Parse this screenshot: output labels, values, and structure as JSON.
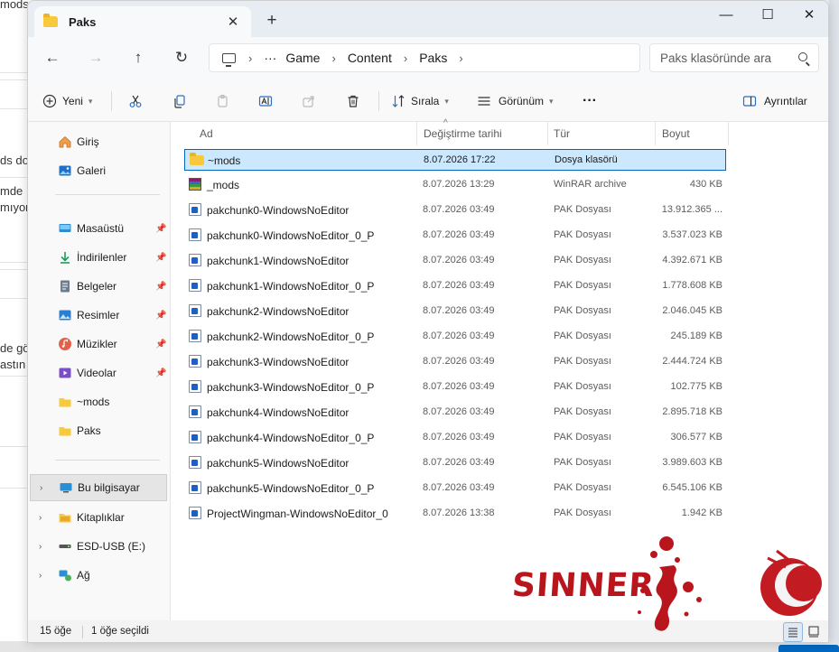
{
  "background": {
    "fragments": [
      "mods",
      "ds do",
      "mde",
      "mıyor",
      "de gö",
      "astın"
    ]
  },
  "titlebar": {
    "tab_title": "Paks",
    "close_tab": "✕",
    "new_tab": "+",
    "minimize": "—",
    "maximize": "☐",
    "close_window": "✕"
  },
  "nav": {
    "back": "←",
    "forward": "→",
    "up": "↑",
    "refresh": "↻",
    "ellipsis": "···",
    "breadcrumb": [
      "Game",
      "Content",
      "Paks"
    ],
    "search_placeholder": "Paks klasöründe ara"
  },
  "commands": {
    "new": "Yeni",
    "sort": "Sırala",
    "view": "Görünüm",
    "more": "···",
    "details": "Ayrıntılar"
  },
  "sidebar": {
    "items": [
      {
        "label": "Giriş",
        "icon": "home-icon"
      },
      {
        "label": "Galeri",
        "icon": "gallery-icon"
      },
      {
        "label": "Masaüstü",
        "icon": "desktop-icon",
        "pinned": true
      },
      {
        "label": "İndirilenler",
        "icon": "downloads-icon",
        "pinned": true
      },
      {
        "label": "Belgeler",
        "icon": "documents-icon",
        "pinned": true
      },
      {
        "label": "Resimler",
        "icon": "pictures-icon",
        "pinned": true
      },
      {
        "label": "Müzikler",
        "icon": "music-icon",
        "pinned": true
      },
      {
        "label": "Videolar",
        "icon": "videos-icon",
        "pinned": true
      },
      {
        "label": "~mods",
        "icon": "folder-icon"
      },
      {
        "label": "Paks",
        "icon": "folder-icon"
      },
      {
        "label": "Bu bilgisayar",
        "icon": "this-pc-icon",
        "expandable": true,
        "selected": true
      },
      {
        "label": "Kitaplıklar",
        "icon": "libraries-icon",
        "expandable": true
      },
      {
        "label": "ESD-USB (E:)",
        "icon": "usb-drive-icon",
        "expandable": true
      },
      {
        "label": "Ağ",
        "icon": "network-icon",
        "expandable": true
      }
    ]
  },
  "columns": {
    "name": "Ad",
    "modified": "Değiştirme tarihi",
    "type": "Tür",
    "size": "Boyut"
  },
  "files": [
    {
      "name": "~mods",
      "date": "8.07.2026 17:22",
      "type": "Dosya klasörü",
      "size": "",
      "kind": "folder"
    },
    {
      "name": "_mods",
      "date": "8.07.2026 13:29",
      "type": "WinRAR archive",
      "size": "430 KB",
      "kind": "rar"
    },
    {
      "name": "pakchunk0-WindowsNoEditor",
      "date": "8.07.2026 03:49",
      "type": "PAK Dosyası",
      "size": "13.912.365 ...",
      "kind": "pak"
    },
    {
      "name": "pakchunk0-WindowsNoEditor_0_P",
      "date": "8.07.2026 03:49",
      "type": "PAK Dosyası",
      "size": "3.537.023 KB",
      "kind": "pak"
    },
    {
      "name": "pakchunk1-WindowsNoEditor",
      "date": "8.07.2026 03:49",
      "type": "PAK Dosyası",
      "size": "4.392.671 KB",
      "kind": "pak"
    },
    {
      "name": "pakchunk1-WindowsNoEditor_0_P",
      "date": "8.07.2026 03:49",
      "type": "PAK Dosyası",
      "size": "1.778.608 KB",
      "kind": "pak"
    },
    {
      "name": "pakchunk2-WindowsNoEditor",
      "date": "8.07.2026 03:49",
      "type": "PAK Dosyası",
      "size": "2.046.045 KB",
      "kind": "pak"
    },
    {
      "name": "pakchunk2-WindowsNoEditor_0_P",
      "date": "8.07.2026 03:49",
      "type": "PAK Dosyası",
      "size": "245.189 KB",
      "kind": "pak"
    },
    {
      "name": "pakchunk3-WindowsNoEditor",
      "date": "8.07.2026 03:49",
      "type": "PAK Dosyası",
      "size": "2.444.724 KB",
      "kind": "pak"
    },
    {
      "name": "pakchunk3-WindowsNoEditor_0_P",
      "date": "8.07.2026 03:49",
      "type": "PAK Dosyası",
      "size": "102.775 KB",
      "kind": "pak"
    },
    {
      "name": "pakchunk4-WindowsNoEditor",
      "date": "8.07.2026 03:49",
      "type": "PAK Dosyası",
      "size": "2.895.718 KB",
      "kind": "pak"
    },
    {
      "name": "pakchunk4-WindowsNoEditor_0_P",
      "date": "8.07.2026 03:49",
      "type": "PAK Dosyası",
      "size": "306.577 KB",
      "kind": "pak"
    },
    {
      "name": "pakchunk5-WindowsNoEditor",
      "date": "8.07.2026 03:49",
      "type": "PAK Dosyası",
      "size": "3.989.603 KB",
      "kind": "pak"
    },
    {
      "name": "pakchunk5-WindowsNoEditor_0_P",
      "date": "8.07.2026 03:49",
      "type": "PAK Dosyası",
      "size": "6.545.106 KB",
      "kind": "pak"
    },
    {
      "name": "ProjectWingman-WindowsNoEditor_0",
      "date": "8.07.2026 13:38",
      "type": "PAK Dosyası",
      "size": "1.942 KB",
      "kind": "pak"
    }
  ],
  "status": {
    "count": "15 öğe",
    "selected": "1 öğe seçildi"
  },
  "watermark": {
    "text": "SINNER",
    "color": "#b8151d"
  },
  "colors": {
    "selection_bg": "#cce8ff",
    "selection_border": "#0067c0",
    "folder": "#f8c93c"
  }
}
